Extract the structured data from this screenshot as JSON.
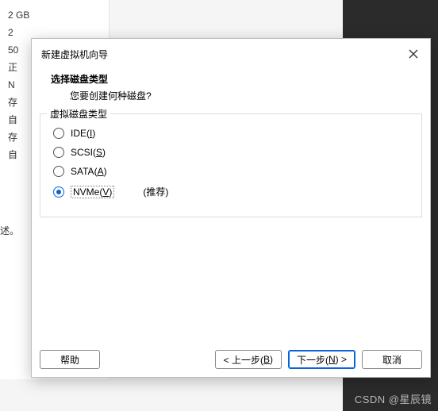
{
  "background": {
    "items": [
      "2 GB",
      "2",
      "50",
      "正",
      "N",
      "存",
      "自",
      "存",
      "自"
    ],
    "desc": "述。"
  },
  "dialog": {
    "title": "新建虚拟机向导",
    "header_title": "选择磁盘类型",
    "header_sub": "您要创建何种磁盘?",
    "group_label": "虚拟磁盘类型",
    "options": {
      "ide": {
        "text": "IDE",
        "accel": "I",
        "selected": false
      },
      "scsi": {
        "text": "SCSI",
        "accel": "S",
        "selected": false
      },
      "sata": {
        "text": "SATA",
        "accel": "A",
        "selected": false
      },
      "nvme": {
        "text": "NVMe",
        "accel": "V",
        "selected": true,
        "recommended": "(推荐)"
      }
    },
    "buttons": {
      "help": "帮助",
      "back_prefix": "< 上一步(",
      "back_accel": "B",
      "back_suffix": ")",
      "next_prefix": "下一步(",
      "next_accel": "N",
      "next_suffix": ") >",
      "cancel": "取消"
    }
  },
  "watermark": "CSDN @星辰镜"
}
